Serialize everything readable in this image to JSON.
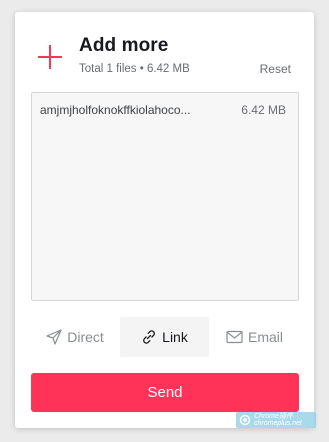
{
  "header": {
    "title": "Add more",
    "subtitle": "Total 1 files • 6.42 MB",
    "reset_label": "Reset"
  },
  "files": [
    {
      "name": "amjmjholfoknokffkiolahoco...",
      "size": "6.42 MB"
    }
  ],
  "tabs": [
    {
      "label": "Direct",
      "icon": "send-arrow-icon",
      "active": false
    },
    {
      "label": "Link",
      "icon": "link-icon",
      "active": true
    },
    {
      "label": "Email",
      "icon": "envelope-icon",
      "active": false
    }
  ],
  "send_label": "Send",
  "watermark": {
    "line1": "Chrome插件",
    "line2": "chromeplus.net"
  },
  "colors": {
    "accent": "#ff3358",
    "background": "#ebebeb",
    "panel": "#ffffff"
  }
}
